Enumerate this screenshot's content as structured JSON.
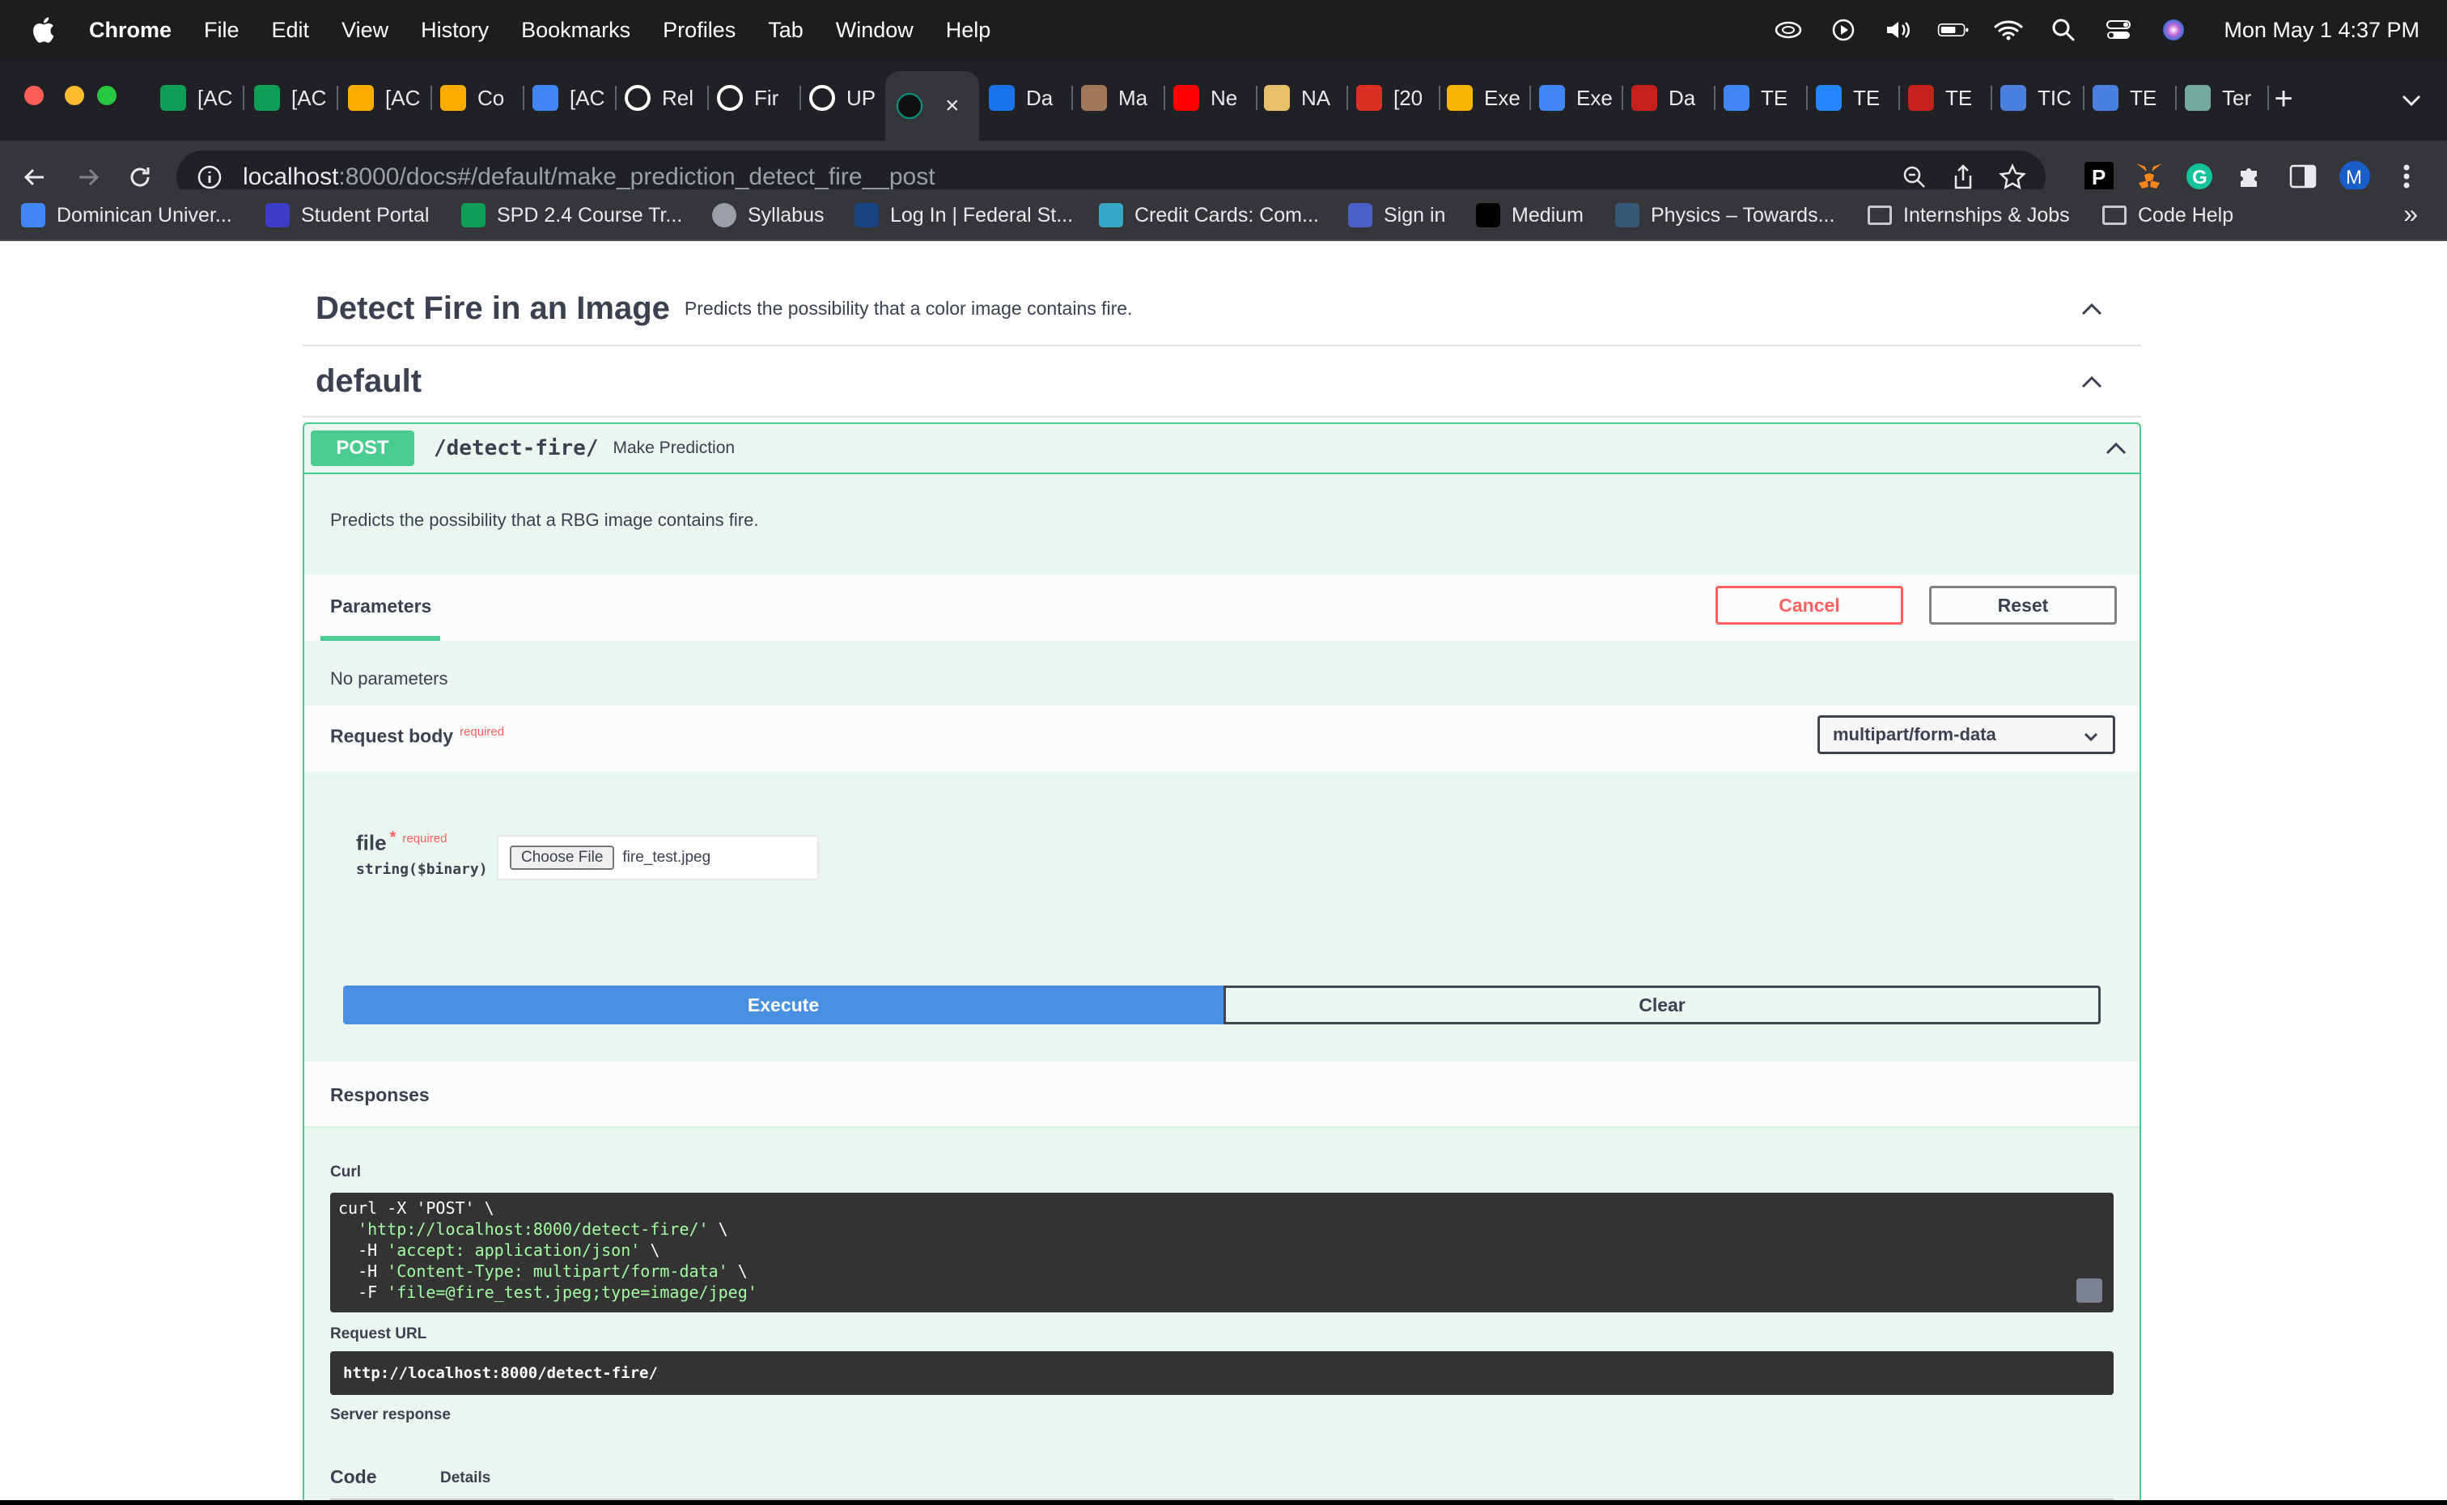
{
  "menubar": {
    "app": "Chrome",
    "items": [
      "File",
      "Edit",
      "View",
      "History",
      "Bookmarks",
      "Profiles",
      "Tab",
      "Window",
      "Help"
    ],
    "clock": "Mon May 1  4:37 PM"
  },
  "tabs": [
    {
      "label": "[AC",
      "icon": "sheets-icon",
      "color": "#0f9d58"
    },
    {
      "label": "[AC",
      "icon": "sheets-icon",
      "color": "#0f9d58"
    },
    {
      "label": "[AC",
      "icon": "colab-icon",
      "color": "#f9ab00"
    },
    {
      "label": "Co",
      "icon": "colab-icon",
      "color": "#f9ab00"
    },
    {
      "label": "[AC",
      "icon": "docs-icon",
      "color": "#4285f4"
    },
    {
      "label": "Rel",
      "icon": "github-icon",
      "color": "#ffffff"
    },
    {
      "label": "Fir",
      "icon": "github-icon",
      "color": "#ffffff"
    },
    {
      "label": "UP",
      "icon": "github-icon",
      "color": "#ffffff"
    },
    {
      "label": "",
      "icon": "fastapi-icon",
      "color": "#009688",
      "active": true
    },
    {
      "label": "Da",
      "icon": "streamlit-icon",
      "color": "#1a73e8"
    },
    {
      "label": "Ma",
      "icon": "profile-icon",
      "color": "#a0785a"
    },
    {
      "label": "Ne",
      "icon": "youtube-icon",
      "color": "#ff0000"
    },
    {
      "label": "NA",
      "icon": "planet-icon",
      "color": "#e8c06a"
    },
    {
      "label": "[20",
      "icon": "x-icon",
      "color": "#d93025"
    },
    {
      "label": "Exe",
      "icon": "k-icon",
      "color": "#f4b400"
    },
    {
      "label": "Exe",
      "icon": "k-icon",
      "color": "#4285f4"
    },
    {
      "label": "Da",
      "icon": "bars-icon",
      "color": "#c5221f"
    },
    {
      "label": "TE",
      "icon": "globe-icon",
      "color": "#4285f4"
    },
    {
      "label": "TE",
      "icon": "confluence-icon",
      "color": "#2684ff"
    },
    {
      "label": "TE",
      "icon": "bars-icon",
      "color": "#c5221f"
    },
    {
      "label": "TIC",
      "icon": "m-icon",
      "color": "#4a7fe0"
    },
    {
      "label": "TE",
      "icon": "m-icon",
      "color": "#4a7fe0"
    },
    {
      "label": "Ter",
      "icon": "openai-icon",
      "color": "#74aa9c"
    }
  ],
  "address": {
    "host": "localhost",
    "rest": ":8000/docs#/default/make_prediction_detect_fire__post"
  },
  "bookmarks": [
    {
      "label": "Dominican Univer...",
      "icon": "calendar-icon",
      "color": "#4285f4"
    },
    {
      "label": "Student Portal",
      "icon": "portal-icon",
      "color": "#3c3cc8"
    },
    {
      "label": "SPD 2.4 Course Tr...",
      "icon": "sheets-icon",
      "color": "#0f9d58"
    },
    {
      "label": "Syllabus",
      "icon": "globe-icon",
      "color": "#9aa0a6"
    },
    {
      "label": "Log In | Federal St...",
      "icon": "fsa-icon",
      "color": "#1a4480"
    },
    {
      "label": "Credit Cards: Com...",
      "icon": "drop-icon",
      "color": "#38a8c8"
    },
    {
      "label": "Sign in",
      "icon": "people-icon",
      "color": "#4a5fc8"
    },
    {
      "label": "Medium",
      "icon": "medium-icon",
      "color": "#000000"
    },
    {
      "label": "Physics – Towards...",
      "icon": "tds-icon",
      "color": "#355876"
    },
    {
      "label": "Internships & Jobs",
      "icon": "folder-icon",
      "color": "#9aa0a6"
    },
    {
      "label": "Code Help",
      "icon": "folder-icon",
      "color": "#9aa0a6"
    }
  ],
  "bookmarks_more": "»",
  "swagger": {
    "tag1": {
      "name": "Detect Fire in an Image",
      "desc": "Predicts the possibility that a color image contains fire."
    },
    "tag2": {
      "name": "default"
    },
    "op": {
      "method": "POST",
      "path": "/detect-fire/",
      "summary": "Make Prediction",
      "description": "Predicts the possibility that a RBG image contains fire."
    },
    "params": {
      "tab": "Parameters",
      "cancel": "Cancel",
      "reset": "Reset",
      "none": "No parameters"
    },
    "body": {
      "label": "Request body",
      "required": "required",
      "content_type": "multipart/form-data",
      "field_name": "file",
      "field_star": "*",
      "field_required": "required",
      "field_type": "string($binary)",
      "choose_label": "Choose File",
      "file_value": "fire_test.jpeg"
    },
    "execute": "Execute",
    "clear": "Clear",
    "responses": "Responses",
    "curl_label": "Curl",
    "curl": {
      "l1": "curl -X 'POST' \\",
      "l2": "'http://localhost:8000/detect-fire/'",
      "l3a": "-H ",
      "l3": "'accept: application/json'",
      "l4": "'Content-Type: multipart/form-data'",
      "l5a": "-F ",
      "l5": "'file=@fire_test.jpeg;type=image/jpeg'",
      "cont": " \\"
    },
    "request_url_label": "Request URL",
    "request_url": "http://localhost:8000/detect-fire/",
    "server_response": "Server response",
    "code_hdr": "Code",
    "details_hdr": "Details"
  },
  "colors": {
    "post": "#49cc90",
    "execute": "#4990e2",
    "cancel": "#ff6060"
  }
}
